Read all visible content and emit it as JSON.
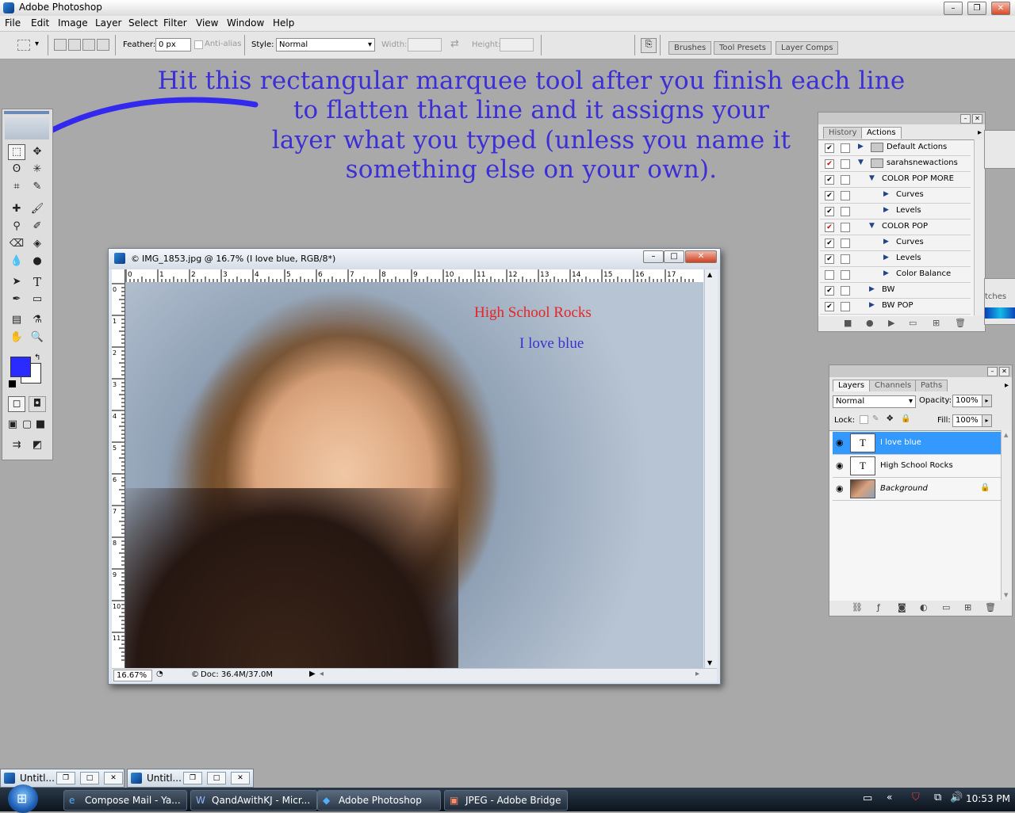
{
  "app": {
    "title": "Adobe Photoshop"
  },
  "menu": [
    "File",
    "Edit",
    "Image",
    "Layer",
    "Select",
    "Filter",
    "View",
    "Window",
    "Help"
  ],
  "options": {
    "feather_label": "Feather:",
    "feather_value": "0 px",
    "antialias_label": "Anti-alias",
    "style_label": "Style:",
    "style_value": "Normal",
    "width_label": "Width:",
    "height_label": "Height:",
    "well_tabs": [
      "Brushes",
      "Tool Presets",
      "Layer Comps"
    ]
  },
  "annotation": {
    "lines": [
      "Hit this rectangular marquee tool after you finish each line",
      "to flatten that line and it assigns your",
      "layer what you typed (unless you name it",
      "something else on your own)."
    ],
    "color": "#3c2fd6"
  },
  "document": {
    "title": "IMG_1853.jpg @ 16.7% (I love blue, RGB/8*)",
    "ruler_numbers": [
      "0",
      "1",
      "2",
      "3",
      "4",
      "5",
      "6",
      "7",
      "8",
      "9",
      "10",
      "11",
      "12",
      "13",
      "14",
      "15",
      "16",
      "17"
    ],
    "vruler_numbers": [
      "0",
      "1",
      "2",
      "3",
      "4",
      "5",
      "6",
      "7",
      "8",
      "9",
      "10",
      "11"
    ],
    "text_red": "High School Rocks",
    "text_blue": "I love blue",
    "zoom": "16.67%",
    "doc_info": "Doc: 36.4M/37.0M"
  },
  "actions_panel": {
    "tabs": [
      "History",
      "Actions"
    ],
    "rows": [
      {
        "label": "Default Actions",
        "kind": "set",
        "open": false,
        "red": false,
        "check": true
      },
      {
        "label": "sarahsnewactions",
        "kind": "set",
        "open": true,
        "red": true,
        "check": true
      },
      {
        "label": "COLOR POP MORE",
        "kind": "action",
        "open": true,
        "red": false,
        "check": true
      },
      {
        "label": "Curves",
        "kind": "step",
        "open": false,
        "red": false,
        "check": true
      },
      {
        "label": "Levels",
        "kind": "step",
        "open": false,
        "red": false,
        "check": true
      },
      {
        "label": "COLOR POP",
        "kind": "action",
        "open": true,
        "red": true,
        "check": true
      },
      {
        "label": "Curves",
        "kind": "step",
        "open": false,
        "red": false,
        "check": true
      },
      {
        "label": "Levels",
        "kind": "step",
        "open": false,
        "red": false,
        "check": true
      },
      {
        "label": "Color Balance",
        "kind": "step",
        "open": false,
        "red": false,
        "check": false
      },
      {
        "label": "BW",
        "kind": "action",
        "open": false,
        "red": false,
        "check": true
      },
      {
        "label": "BW POP",
        "kind": "action",
        "open": false,
        "red": false,
        "check": true
      }
    ]
  },
  "swatch_tab": "tches",
  "layers_panel": {
    "tabs": [
      "Layers",
      "Channels",
      "Paths"
    ],
    "blend_mode": "Normal",
    "opacity_label": "Opacity:",
    "opacity": "100%",
    "lock_label": "Lock:",
    "fill_label": "Fill:",
    "fill": "100%",
    "layers": [
      {
        "name": "I love blue",
        "type": "T",
        "selected": true
      },
      {
        "name": "High School Rocks",
        "type": "T",
        "selected": false
      },
      {
        "name": "Background",
        "type": "img",
        "selected": false
      }
    ]
  },
  "minimized": [
    {
      "label": "Untitl..."
    },
    {
      "label": "Untitl..."
    }
  ],
  "taskbar": {
    "items": [
      "Compose Mail - Ya...",
      "QandAwithKJ - Micr...",
      "Adobe Photoshop",
      "JPEG - Adobe Bridge"
    ],
    "clock": "10:53 PM"
  },
  "colors": {
    "foreground": "#2a2bff",
    "background": "#ffffff",
    "selection": "#3399ff",
    "text_red": "#e32626",
    "text_blue": "#3a34cc"
  }
}
